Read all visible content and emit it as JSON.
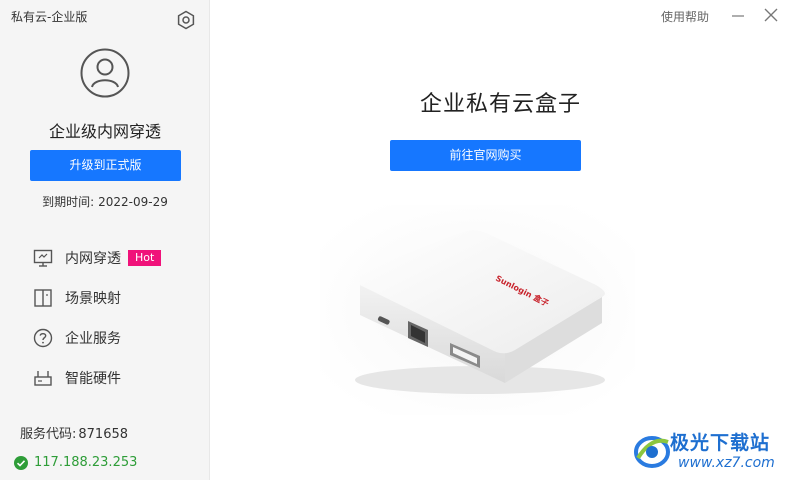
{
  "window": {
    "title": "私有云-企业版",
    "help_label": "使用帮助"
  },
  "sidebar": {
    "plan_name": "企业级内网穿透",
    "upgrade_label": "升级到正式版",
    "expiry_label": "到期时间:",
    "expiry_value": "2022-09-29",
    "nav_items": [
      {
        "label": "内网穿透",
        "icon": "monitor-icon",
        "badge": "Hot"
      },
      {
        "label": "场景映射",
        "icon": "split-panel-icon"
      },
      {
        "label": "企业服务",
        "icon": "help-circle-icon"
      },
      {
        "label": "智能硬件",
        "icon": "router-icon"
      }
    ],
    "service_code_label": "服务代码:",
    "service_code_value": "871658",
    "ip_address": "117.188.23.253"
  },
  "main": {
    "product_title": "企业私有云盒子",
    "buy_label": "前往官网购买",
    "device_brand": "Sunlogin 盒子"
  },
  "watermark": {
    "text": "极光下载站",
    "url": "www.xz7.com"
  },
  "colors": {
    "accent": "#1677ff",
    "hot_badge": "#f0127a",
    "online": "#2e9d38",
    "sidebar_bg": "#f5f5f5"
  }
}
